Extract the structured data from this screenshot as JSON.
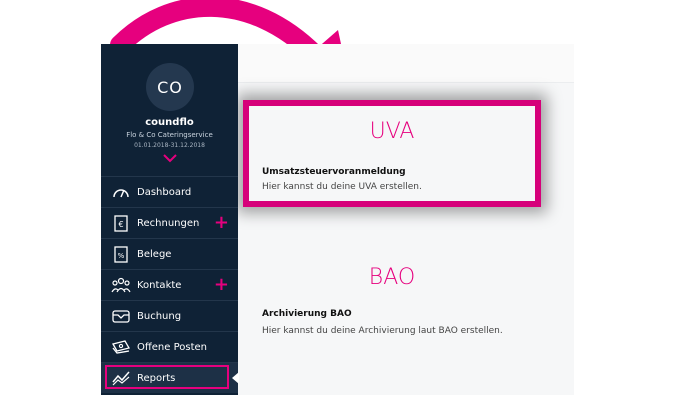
{
  "profile": {
    "initials": "CO",
    "username": "coundflo",
    "company": "Flo & Co Cateringservice",
    "period": "01.01.2018-31.12.2018"
  },
  "sidebar": {
    "items": [
      {
        "label": "Dashboard",
        "icon": "gauge-icon",
        "plus": false
      },
      {
        "label": "Rechnungen",
        "icon": "euro-document-icon",
        "plus": true
      },
      {
        "label": "Belege",
        "icon": "percent-document-icon",
        "plus": false
      },
      {
        "label": "Kontakte",
        "icon": "people-icon",
        "plus": true
      },
      {
        "label": "Buchung",
        "icon": "tray-icon",
        "plus": false
      },
      {
        "label": "Offene Posten",
        "icon": "money-stack-icon",
        "plus": false
      },
      {
        "label": "Reports",
        "icon": "chart-icon",
        "plus": false,
        "active": true
      }
    ],
    "plus_symbol": "+"
  },
  "reports": {
    "uva": {
      "title": "UVA",
      "subtitle": "Umsatzsteuervoranmeldung",
      "description": "Hier kannst du deine UVA erstellen."
    },
    "bao": {
      "title": "BAO",
      "subtitle": "Archivierung BAO",
      "description": "Hier kannst du deine Archivierung laut BAO erstellen."
    }
  },
  "colors": {
    "accent": "#e6007e",
    "sidebar": "#0f2236"
  }
}
